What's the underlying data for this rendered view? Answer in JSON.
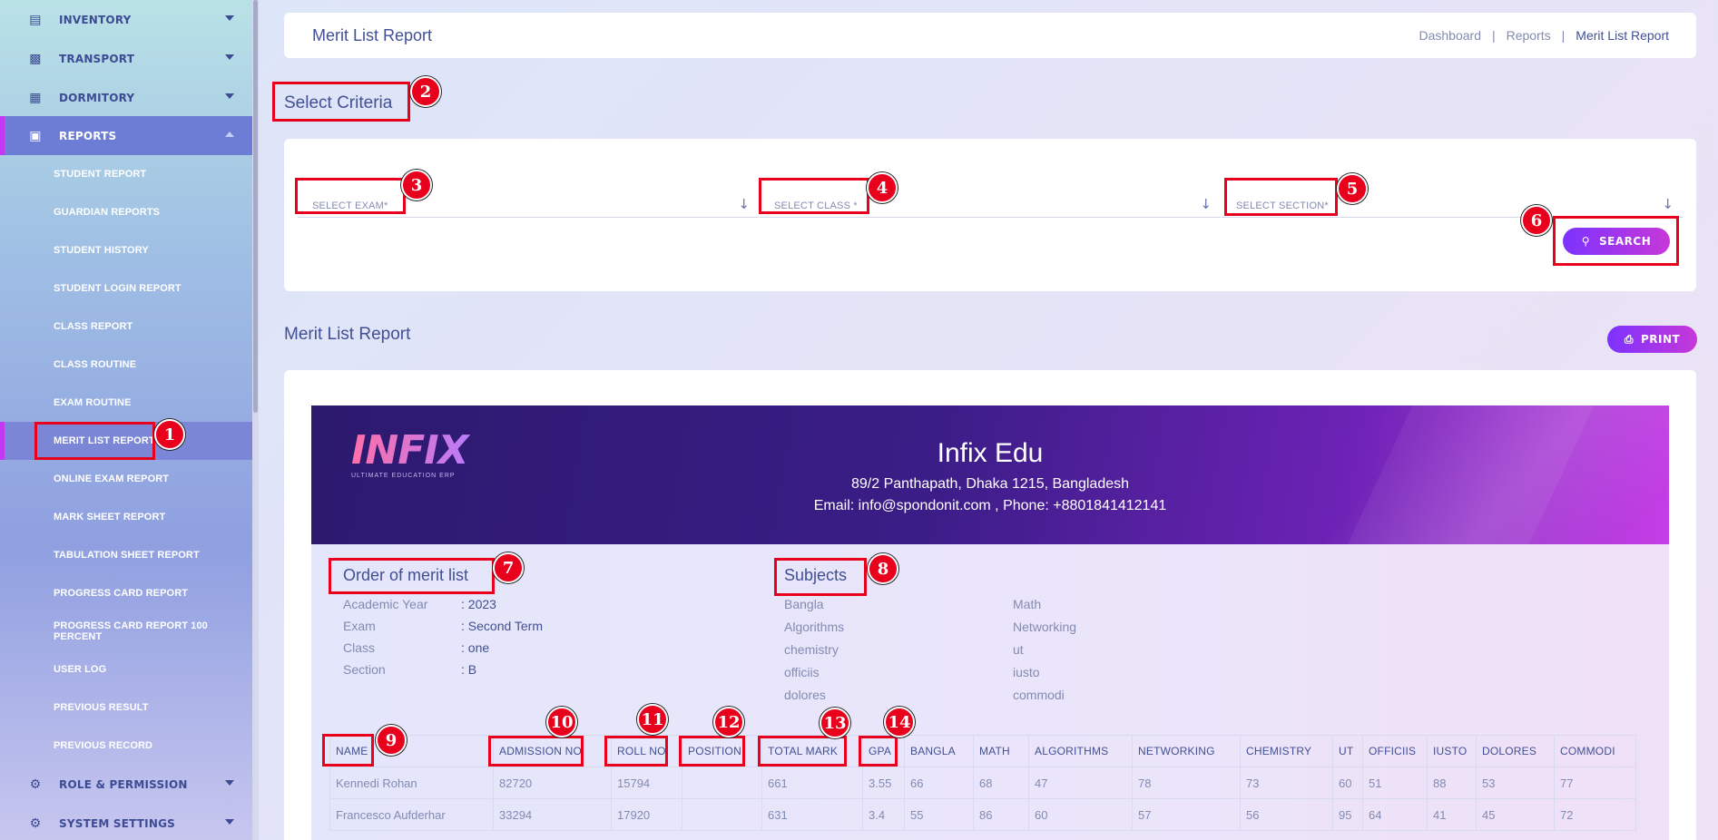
{
  "sidebar": {
    "top_items": [
      {
        "label": "INVENTORY",
        "icon": "inventory-icon"
      },
      {
        "label": "TRANSPORT",
        "icon": "bus-icon"
      },
      {
        "label": "DORMITORY",
        "icon": "dormitory-icon"
      },
      {
        "label": "REPORTS",
        "icon": "reports-icon"
      }
    ],
    "report_items": [
      "STUDENT REPORT",
      "GUARDIAN REPORTS",
      "STUDENT HISTORY",
      "STUDENT LOGIN REPORT",
      "CLASS REPORT",
      "CLASS ROUTINE",
      "EXAM ROUTINE",
      "MERIT LIST REPORT",
      "ONLINE EXAM REPORT",
      "MARK SHEET REPORT",
      "TABULATION SHEET REPORT",
      "PROGRESS CARD REPORT",
      "PROGRESS CARD REPORT 100 PERCENT",
      "USER LOG",
      "PREVIOUS RESULT",
      "PREVIOUS RECORD"
    ],
    "bottom_items": [
      {
        "label": "ROLE & PERMISSION",
        "icon": "permission-icon"
      },
      {
        "label": "SYSTEM SETTINGS",
        "icon": "gear-icon"
      }
    ]
  },
  "header": {
    "title": "Merit List Report",
    "breadcrumb": [
      "Dashboard",
      "Reports",
      "Merit List Report"
    ]
  },
  "criteria": {
    "title": "Select Criteria",
    "exam_placeholder": "SELECT EXAM*",
    "class_placeholder": "SELECT CLASS *",
    "section_placeholder": "SELECT SECTION*",
    "search_label": "SEARCH"
  },
  "report": {
    "title": "Merit List Report",
    "print_label": "PRINT",
    "school": {
      "logo_text": "INFIX",
      "logo_tagline": "ULTIMATE EDUCATION ERP",
      "name": "Infix Edu",
      "address": "89/2 Panthapath, Dhaka 1215, Bangladesh",
      "contact": "Email: info@spondonit.com , Phone: +8801841412141"
    },
    "order": {
      "title": "Order of merit list",
      "rows": [
        {
          "key": "Academic Year",
          "value": ": 2023"
        },
        {
          "key": "Exam",
          "value": ": Second Term"
        },
        {
          "key": "Class",
          "value": ": one"
        },
        {
          "key": "Section",
          "value": ": B"
        }
      ]
    },
    "subjects": {
      "title": "Subjects",
      "left": [
        "Bangla",
        "Algorithms",
        "chemistry",
        "officiis",
        "dolores"
      ],
      "right": [
        "Math",
        "Networking",
        "ut",
        "iusto",
        "commodi"
      ]
    },
    "table": {
      "headers": [
        "NAME",
        "ADMISSION NO",
        "ROLL NO",
        "POSITION",
        "TOTAL MARK",
        "GPA",
        "BANGLA",
        "MATH",
        "ALGORITHMS",
        "NETWORKING",
        "CHEMISTRY",
        "UT",
        "OFFICIIS",
        "IUSTO",
        "DOLORES",
        "COMMODI"
      ],
      "rows": [
        [
          "Kennedi Rohan",
          "82720",
          "15794",
          "",
          "661",
          "3.55",
          "66",
          "68",
          "47",
          "78",
          "73",
          "60",
          "51",
          "88",
          "53",
          "77"
        ],
        [
          "Francesco Aufderhar",
          "33294",
          "17920",
          "",
          "631",
          "3.4",
          "55",
          "86",
          "60",
          "57",
          "56",
          "95",
          "64",
          "41",
          "45",
          "72"
        ]
      ]
    }
  },
  "annotations": [
    "1",
    "2",
    "3",
    "4",
    "5",
    "6",
    "7",
    "8",
    "9",
    "10",
    "11",
    "12",
    "13",
    "14"
  ]
}
